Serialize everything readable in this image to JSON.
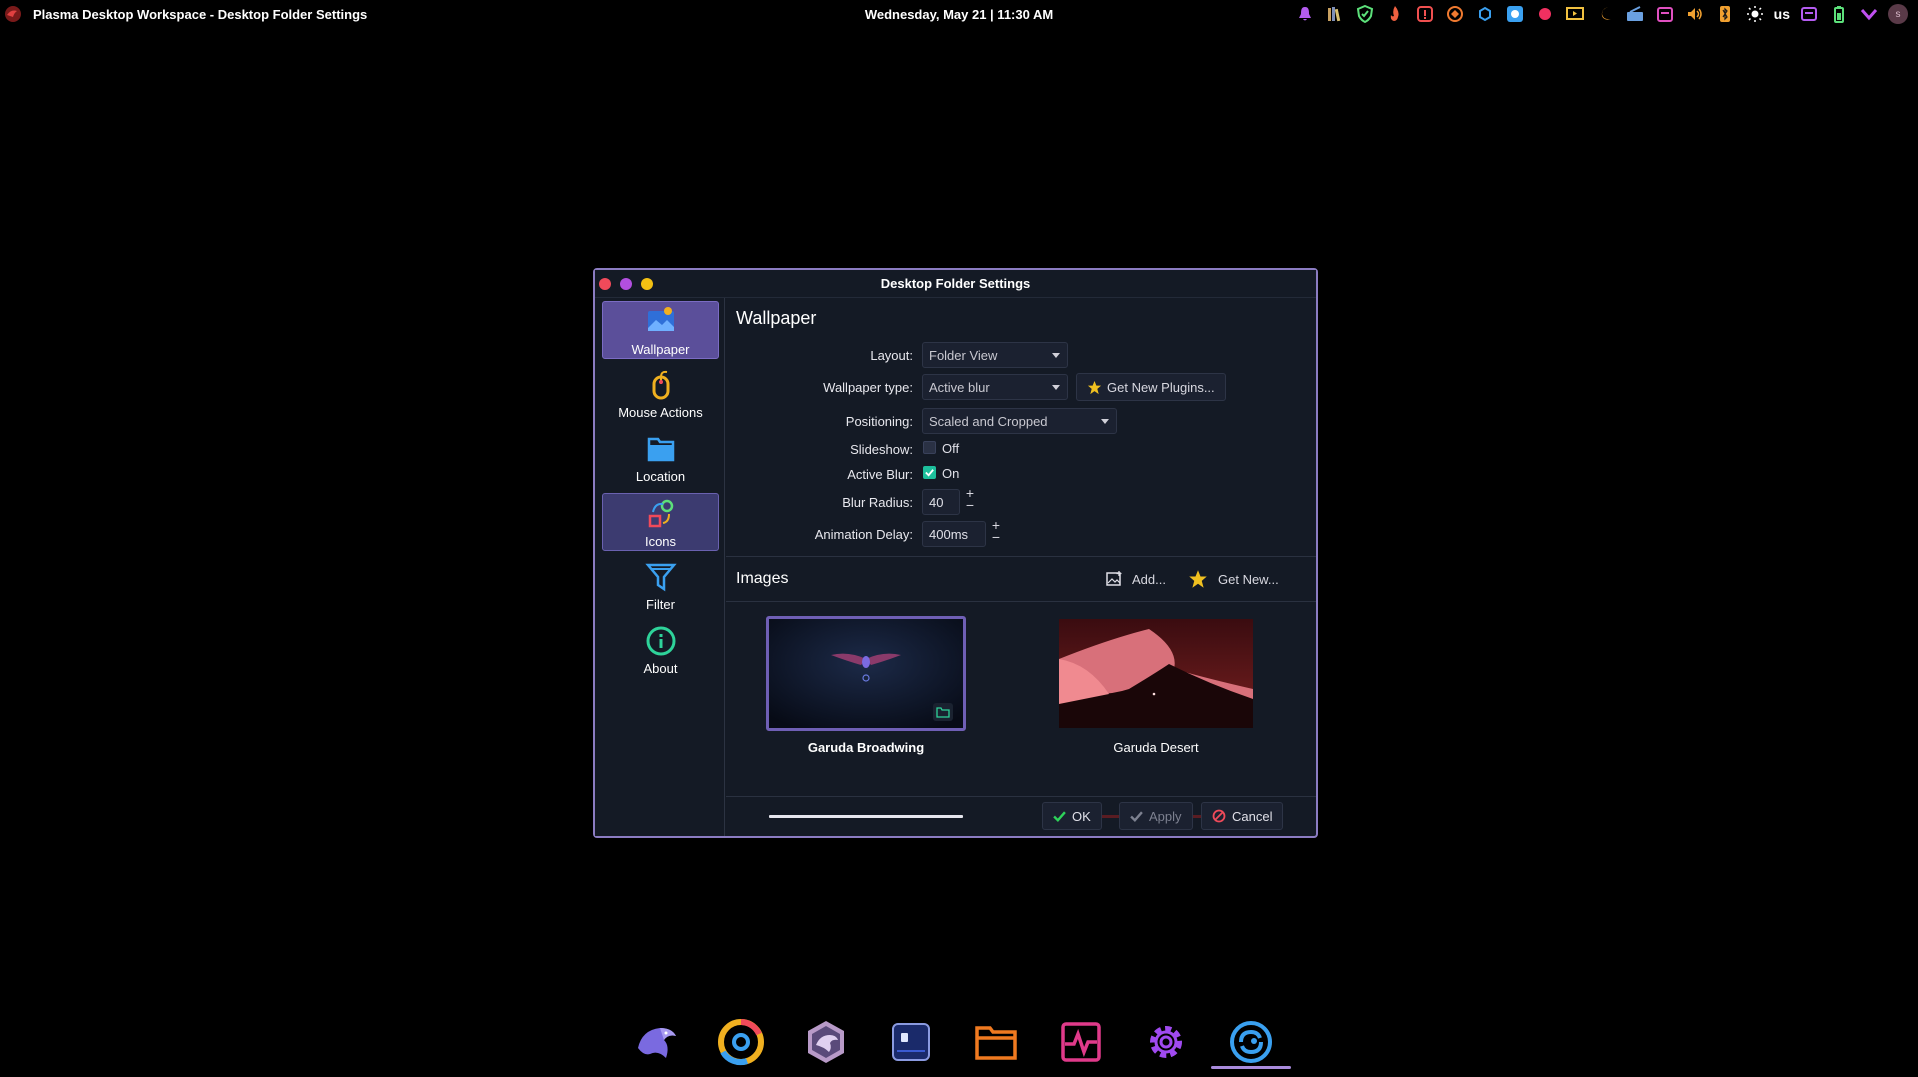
{
  "topbar": {
    "window_title": "Plasma Desktop Workspace - Desktop Folder Settings",
    "clock": "Wednesday, May 21 | 11:30 AM",
    "keyboard_layout": "us",
    "user_initial": "s",
    "tray_icons": [
      "bell-icon",
      "library-icon",
      "shield-icon",
      "fire-icon",
      "warning-icon",
      "sync-icon",
      "cloud-icon",
      "browser-icon",
      "record-icon",
      "presentation-icon",
      "night-light-icon",
      "network-icon",
      "calendar-icon",
      "volume-icon",
      "bluetooth-icon",
      "brightness-icon",
      "keyboard-icon",
      "battery-icon",
      "expand-icon"
    ]
  },
  "dialog": {
    "title": "Desktop Folder Settings",
    "sidebar": [
      {
        "label": "Wallpaper",
        "icon": "wallpaper-icon",
        "state": "active"
      },
      {
        "label": "Mouse Actions",
        "icon": "mouse-icon",
        "state": "normal"
      },
      {
        "label": "Location",
        "icon": "folder-icon",
        "state": "normal"
      },
      {
        "label": "Icons",
        "icon": "icons-icon",
        "state": "hover"
      },
      {
        "label": "Filter",
        "icon": "filter-icon",
        "state": "normal"
      },
      {
        "label": "About",
        "icon": "info-icon",
        "state": "normal"
      }
    ],
    "section_title": "Wallpaper",
    "layout": {
      "label": "Layout:",
      "value": "Folder View"
    },
    "wallpaper_type": {
      "label": "Wallpaper type:",
      "value": "Active blur",
      "plugins_button": "Get New Plugins..."
    },
    "positioning": {
      "label": "Positioning:",
      "value": "Scaled and Cropped"
    },
    "slideshow": {
      "label": "Slideshow:",
      "checked": false,
      "state_text": "Off"
    },
    "active_blur": {
      "label": "Active Blur:",
      "checked": true,
      "state_text": "On"
    },
    "blur_radius": {
      "label": "Blur Radius:",
      "value": "40"
    },
    "animation_delay": {
      "label": "Animation Delay:",
      "value": "400ms"
    },
    "images": {
      "title": "Images",
      "add_button": "Add...",
      "get_new_button": "Get New...",
      "items": [
        {
          "name": "Garuda Broadwing",
          "selected": true
        },
        {
          "name": "Garuda Desert",
          "selected": false
        }
      ]
    },
    "footer": {
      "ok": "OK",
      "apply": "Apply",
      "cancel": "Cancel"
    }
  },
  "dock": {
    "apps": [
      "garuda-icon",
      "chromium-icon",
      "garuda-welcome-icon",
      "terminal-icon",
      "files-icon",
      "system-monitor-icon",
      "settings-icon",
      "garuda-settings-icon"
    ],
    "active_index": 7
  },
  "colors": {
    "accent": "#8b7cc2",
    "active_sidebar": "#5b4f9a",
    "checkbox_on": "#1dbf9c",
    "background": "#000000",
    "dialog_bg": "#141a25"
  }
}
